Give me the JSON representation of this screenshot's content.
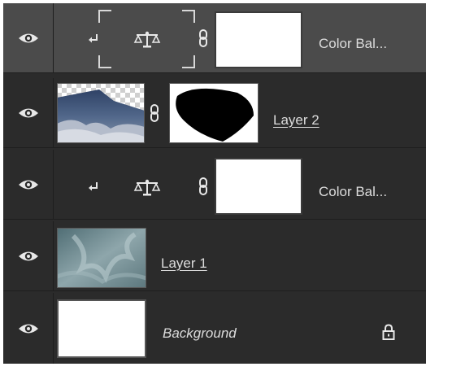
{
  "layers": [
    {
      "name": "Color Bal...",
      "type": "adjustment",
      "selected": true,
      "clipped": true
    },
    {
      "name": "Layer 2",
      "type": "pixel-mask",
      "selected": false
    },
    {
      "name": "Color Bal...",
      "type": "adjustment",
      "selected": false,
      "clipped": true
    },
    {
      "name": "Layer 1",
      "type": "pixel",
      "selected": false
    },
    {
      "name": "Background",
      "type": "background",
      "selected": false,
      "locked": true
    }
  ],
  "icons": {
    "visibility": "eye-icon",
    "adjustment": "scales-icon",
    "link": "chain-link-icon",
    "clip": "clipping-arrow-icon",
    "lock": "lock-icon"
  },
  "colors": {
    "panel": "#2b2b2b",
    "selected_row": "#4b4b4b",
    "text": "#dcdcdc"
  }
}
